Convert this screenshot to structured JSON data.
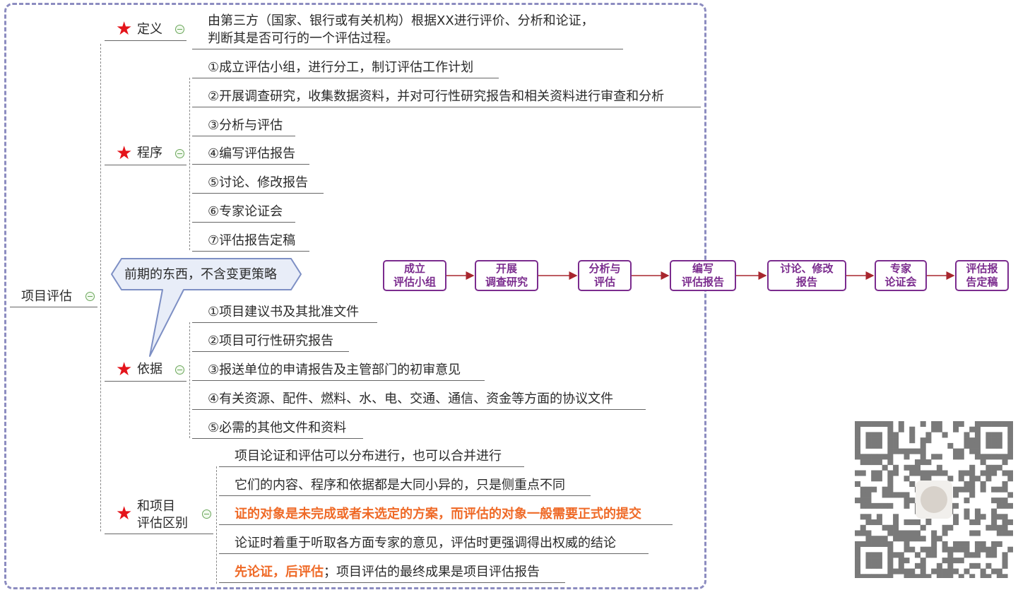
{
  "root": {
    "label": "项目评估"
  },
  "callout": {
    "text": "前期的东西，不含变更策略"
  },
  "branches": {
    "definition": {
      "label": "定义",
      "leaf_line1": "由第三方（国家、银行或有关机构）根据XX进行评价、分析和论证，",
      "leaf_line2": "判断其是否可行的一个评估过程。"
    },
    "procedure": {
      "label": "程序",
      "items": [
        "①成立评估小组，进行分工，制订评估工作计划",
        "②开展调查研究，收集数据资料，并对可行性研究报告和相关资料进行审查和分析",
        "③分析与评估",
        "④编写评估报告",
        "⑤讨论、修改报告",
        "⑥专家论证会",
        "⑦评估报告定稿"
      ]
    },
    "basis": {
      "label": "依据",
      "items": [
        "①项目建议书及其批准文件",
        "②项目可行性研究报告",
        "③报送单位的申请报告及主管部门的初审意见",
        "④有关资源、配件、燃料、水、电、交通、通信、资金等方面的协议文件",
        "⑤必需的其他文件和资料"
      ]
    },
    "difference": {
      "label_line1": "和项目",
      "label_line2": "评估区别",
      "items": [
        "项目论证和评估可以分布进行，也可以合并进行",
        "它们的内容、程序和依据都是大同小异的，只是侧重点不同",
        "证的对象是未完成或者未选定的方案，而评估的对象一般需要正式的提交",
        "论证时着重于听取各方面专家的意见，评估时更强调得出权威的结论"
      ],
      "last_item_highlight": "先论证，后评估",
      "last_item_rest": "；项目评估的最终成果是项目评估报告"
    }
  },
  "flow": [
    {
      "line1": "成立",
      "line2": "评估小组"
    },
    {
      "line1": "开展",
      "line2": "调查研究"
    },
    {
      "line1": "分析与",
      "line2": "评估"
    },
    {
      "line1": "编写",
      "line2": "评估报告"
    },
    {
      "line1": "讨论、修改",
      "line2": "报告"
    },
    {
      "line1": "专家",
      "line2": "论证会"
    },
    {
      "line1": "评估报",
      "line2": "告定稿"
    }
  ],
  "colors": {
    "star": "#e4141b",
    "highlight": "#ef6a27",
    "flow": "#7b2c8e",
    "frame": "#8c8cc0",
    "callout_fill": "#e8edf8",
    "callout_stroke": "#7d8fc4"
  }
}
